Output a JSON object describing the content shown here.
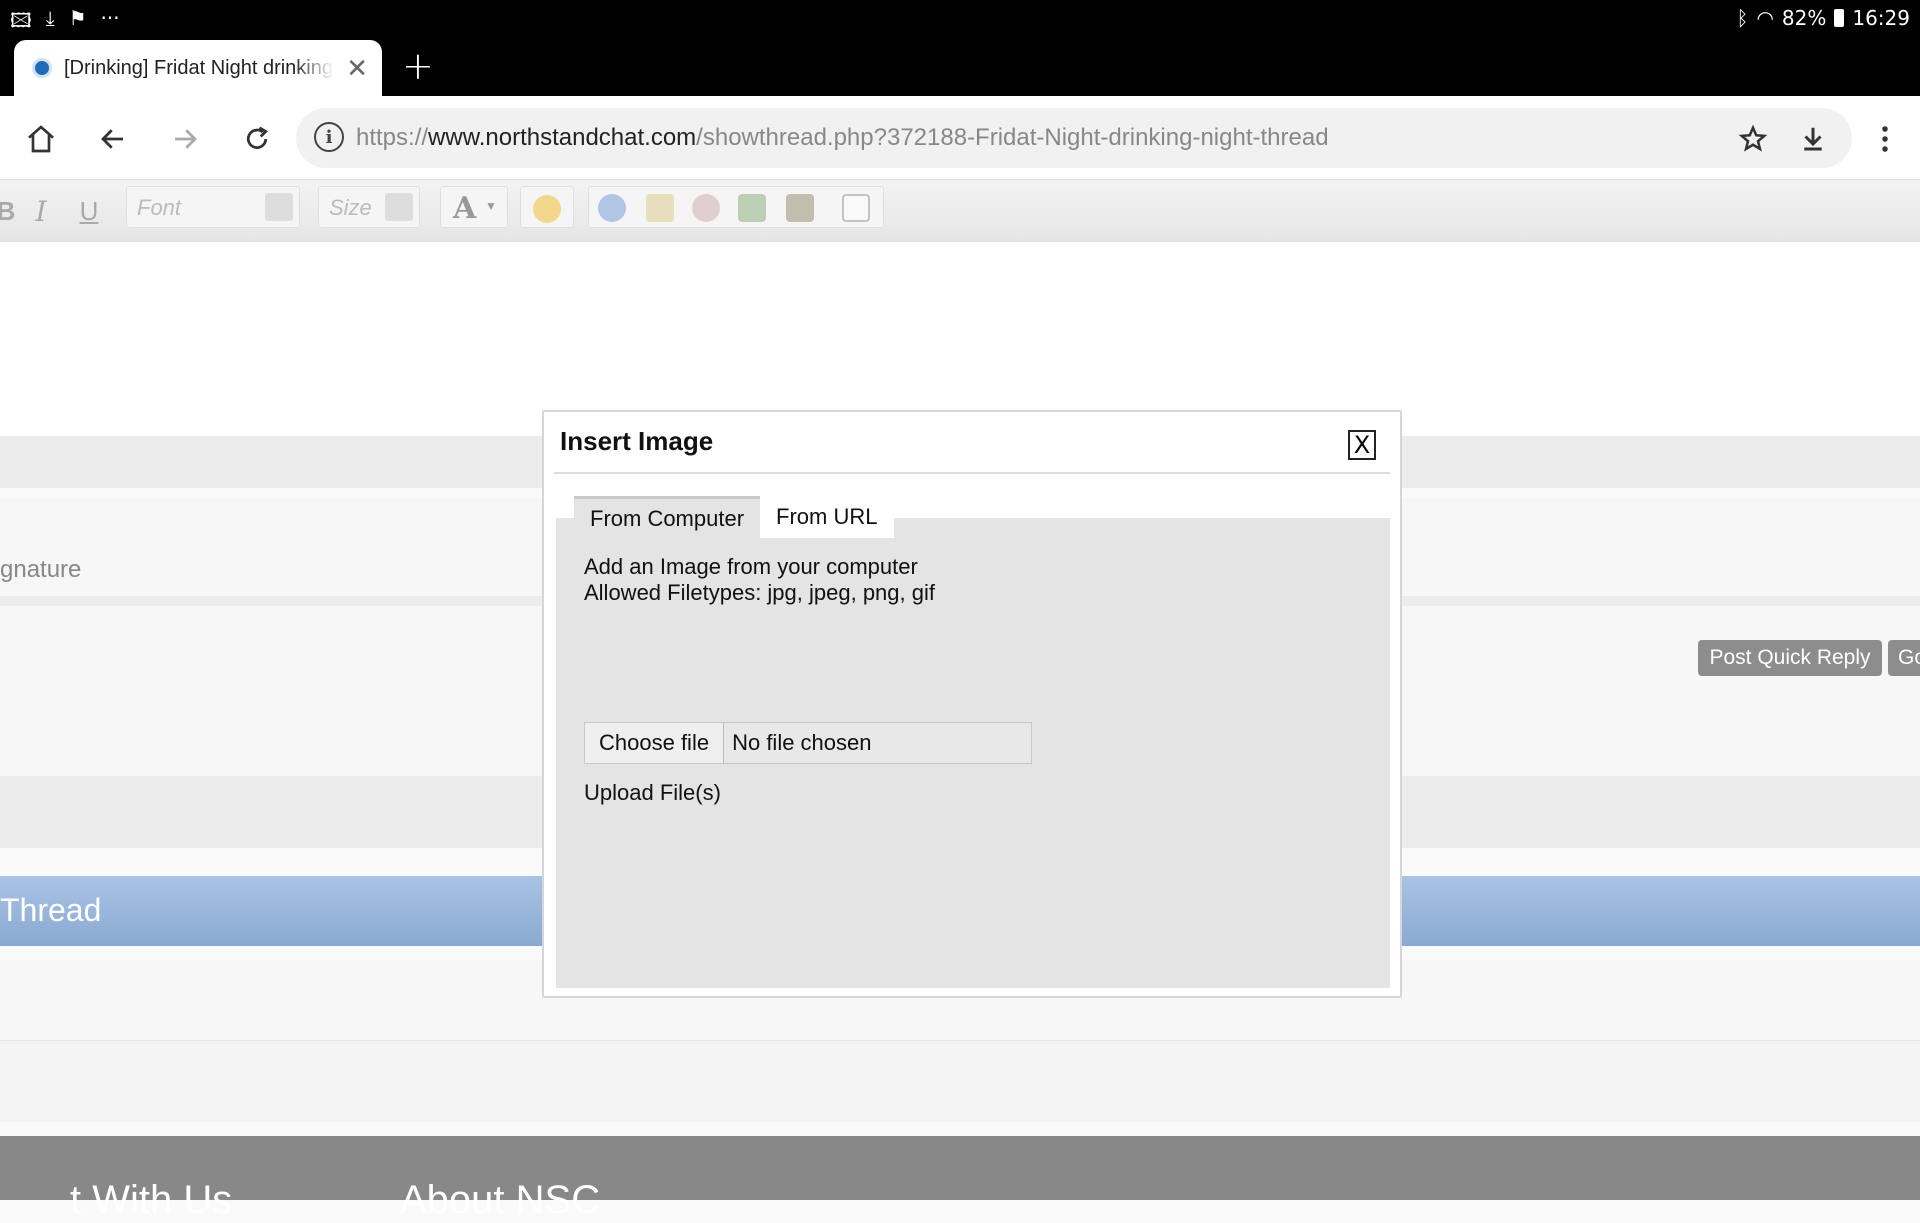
{
  "status_bar": {
    "left_icons": [
      "image-icon",
      "download-icon",
      "flag-icon",
      "more-icon"
    ],
    "more_glyph": "···",
    "battery": "82%",
    "time": "16:29"
  },
  "browser": {
    "tab_title": "[Drinking] Fridat Night drinking night thread",
    "url_prefix": "https://",
    "url_host": "www.northstandchat.com",
    "url_path": "/showthread.php?372188-Fridat-Night-drinking-night-thread"
  },
  "editor": {
    "font_placeholder": "Font",
    "size_placeholder": "Size"
  },
  "page": {
    "signature_label": "gnature",
    "post_quick_reply": "Post Quick Reply",
    "go_label": "Go",
    "thread_heading": "Thread",
    "footer_left": "t With Us",
    "footer_right": "About NSC"
  },
  "dialog": {
    "title": "Insert Image",
    "close_label": "X",
    "tabs": [
      {
        "label": "From Computer",
        "active": true
      },
      {
        "label": "From URL",
        "active": false
      }
    ],
    "intro": "Add an Image from your computer",
    "allowed": "Allowed Filetypes: jpg, jpeg, png, gif",
    "choose_file": "Choose file",
    "no_file": "No file chosen",
    "upload": "Upload File(s)"
  },
  "colors": {
    "thread_bar": "#99b6dc",
    "button_gray": "#8d8d8d",
    "panel_bg": "#e4e4e4"
  }
}
